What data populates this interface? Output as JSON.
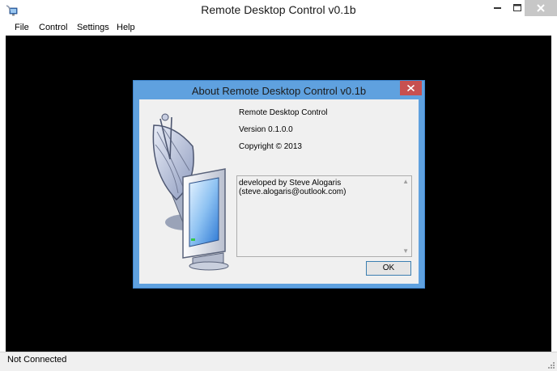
{
  "window": {
    "title": "Remote Desktop Control v0.1b",
    "icons": {
      "app": "remote-desktop-app-icon",
      "minimize": "minimize-icon",
      "maximize": "maximize-icon",
      "close": "close-icon"
    }
  },
  "menu": [
    {
      "label": "File"
    },
    {
      "label": "Control"
    },
    {
      "label": "Settings"
    },
    {
      "label": "Help"
    }
  ],
  "status": {
    "text": "Not Connected"
  },
  "dialog": {
    "title": "About Remote Desktop Control v0.1b",
    "product": "Remote Desktop Control",
    "version": "Version 0.1.0.0",
    "copyright": "Copyright © 2013",
    "description_lines": [
      "developed by Steve Alogaris",
      "(steve.alogaris@outlook.com)"
    ],
    "ok_label": "OK",
    "logo_icon": "satellite-dish-monitor-icon"
  },
  "colors": {
    "workspace": "#000000",
    "dialog_frame": "#5fa1df",
    "dialog_close": "#c75050",
    "window_close": "#c7c7c7"
  }
}
